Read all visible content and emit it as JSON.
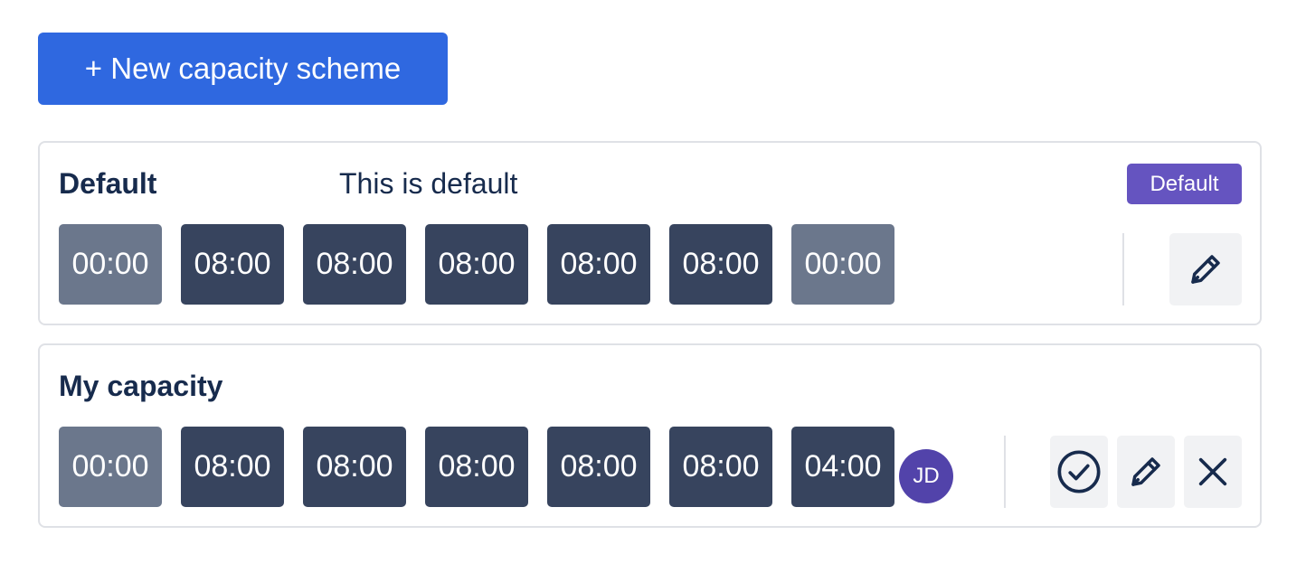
{
  "new_button": {
    "label": "+ New capacity scheme"
  },
  "schemes": [
    {
      "title": "Default",
      "description": "This is default",
      "badge": "Default",
      "days": [
        "00:00",
        "08:00",
        "08:00",
        "08:00",
        "08:00",
        "08:00",
        "00:00"
      ],
      "actions": {
        "edit": "pencil-icon"
      }
    },
    {
      "title": "My capacity",
      "days": [
        "00:00",
        "08:00",
        "08:00",
        "08:00",
        "08:00",
        "08:00",
        "04:00"
      ],
      "avatar": "JD",
      "actions": {
        "check": "check-circle-icon",
        "edit": "pencil-icon",
        "close": "close-icon"
      }
    }
  ],
  "colors": {
    "primary": "#2f68e0",
    "badge": "#6554c0",
    "avatar": "#5243aa",
    "day_working": "#37445e",
    "day_off": "#6b778c",
    "icon_button_bg": "#f1f2f4"
  }
}
